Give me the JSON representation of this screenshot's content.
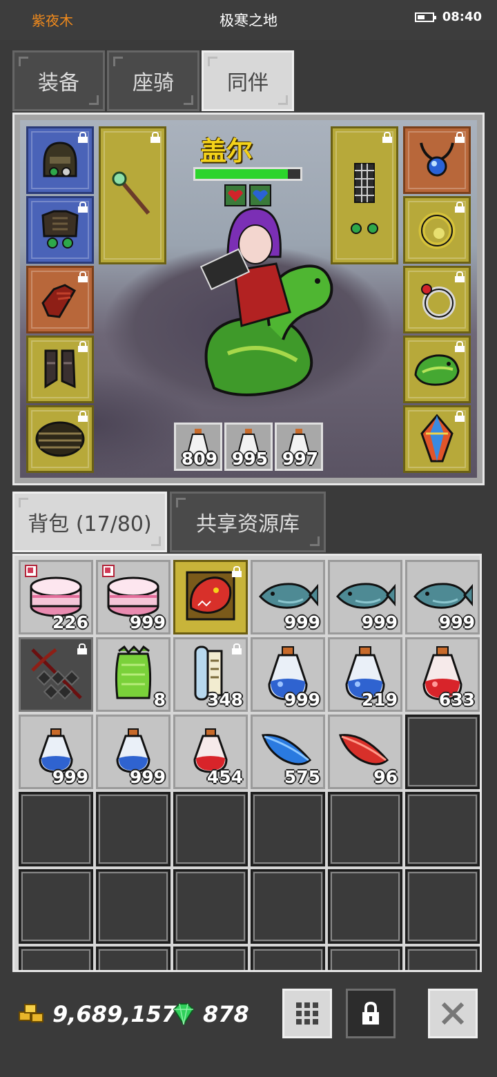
{
  "status_bar": {
    "player_name": "紫夜木",
    "map_name": "极寒之地",
    "time": "08:40"
  },
  "tabs": [
    {
      "label": "装备",
      "active": false
    },
    {
      "label": "座骑",
      "active": false
    },
    {
      "label": "同伴",
      "active": true
    }
  ],
  "companion": {
    "name": "盖尔",
    "hp_fraction": 0.88,
    "potions": [
      {
        "type": "white-potion",
        "count": "809"
      },
      {
        "type": "white-potion",
        "count": "995"
      },
      {
        "type": "white-potion",
        "count": "997"
      }
    ]
  },
  "equip_slots": {
    "left": [
      "helmet-icon",
      "armor-icon",
      "glove-icon",
      "boots-icon",
      "belt-icon"
    ],
    "weapon": "staff-icon",
    "offhand": "cage-icon",
    "right": [
      "amulet-icon",
      "ring-gold-icon",
      "ring-silver-icon",
      "snake-mount-icon",
      "crystal-icon"
    ]
  },
  "bag_tabs": [
    {
      "label": "背包 (17/80)",
      "active": true
    },
    {
      "label": "共享资源库",
      "active": false
    }
  ],
  "inventory": [
    {
      "icon": "cake-icon",
      "count": "226",
      "style": "normal",
      "new": true
    },
    {
      "icon": "cake-icon",
      "count": "999",
      "style": "normal",
      "new": true
    },
    {
      "icon": "dragon-head-icon",
      "count": "",
      "style": "gold",
      "locked": true
    },
    {
      "icon": "fish-icon",
      "count": "999",
      "style": "normal"
    },
    {
      "icon": "fish-icon",
      "count": "999",
      "style": "normal"
    },
    {
      "icon": "fish-icon",
      "count": "999",
      "style": "normal"
    },
    {
      "icon": "crossbow-icon",
      "count": "",
      "style": "dark",
      "locked": true
    },
    {
      "icon": "green-bag-icon",
      "count": "8",
      "style": "normal"
    },
    {
      "icon": "scroll-icon",
      "count": "348",
      "style": "normal",
      "locked": true
    },
    {
      "icon": "blue-potion-icon",
      "count": "999",
      "style": "normal"
    },
    {
      "icon": "blue-potion-icon",
      "count": "219",
      "style": "normal"
    },
    {
      "icon": "red-potion-icon",
      "count": "633",
      "style": "normal"
    },
    {
      "icon": "small-blue-potion-icon",
      "count": "999",
      "style": "normal"
    },
    {
      "icon": "small-blue-potion-icon",
      "count": "999",
      "style": "normal"
    },
    {
      "icon": "small-red-potion-icon",
      "count": "454",
      "style": "normal"
    },
    {
      "icon": "blue-feather-icon",
      "count": "575",
      "style": "normal"
    },
    {
      "icon": "red-feather-icon",
      "count": "96",
      "style": "normal"
    }
  ],
  "inventory_capacity_visible": 24,
  "currency": {
    "gold": "9,689,157",
    "gems": "878"
  },
  "bottom_buttons": [
    "grid-menu-button",
    "lock-button",
    "close-button"
  ],
  "colors": {
    "accent_orange": "#f08a1c",
    "name_yellow": "#f4d21a",
    "hp_green": "#2cd42c"
  }
}
